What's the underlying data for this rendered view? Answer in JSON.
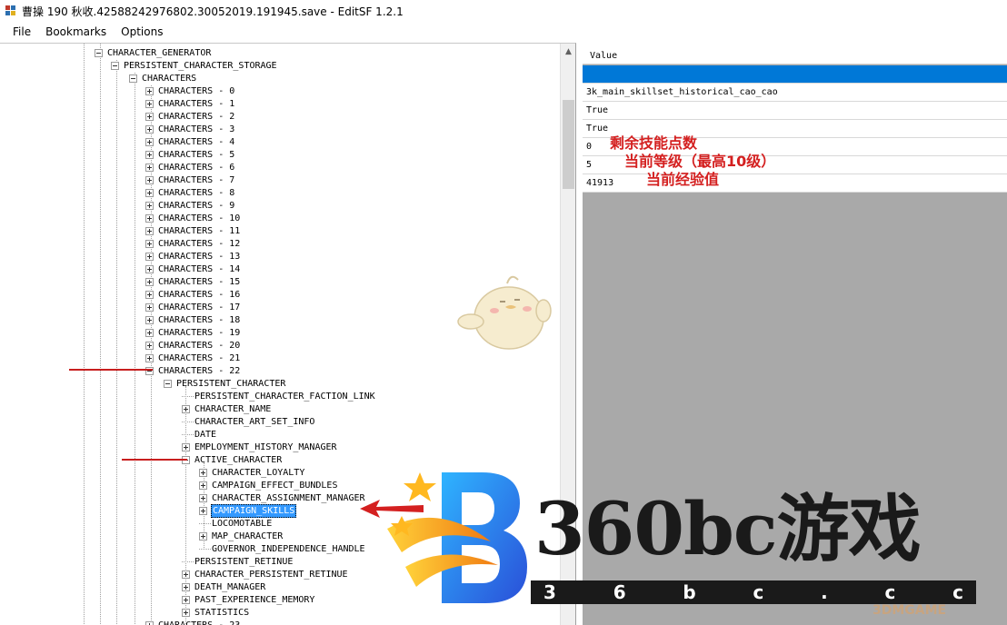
{
  "window": {
    "title": "曹操 190 秋收.42588242976802.30052019.191945.save - EditSF 1.2.1"
  },
  "menu": {
    "items": [
      "File",
      "Bookmarks",
      "Options"
    ]
  },
  "tree": {
    "generator": "CHARACTER_GENERATOR",
    "storage": "PERSISTENT_CHARACTER_STORAGE",
    "characters_root": "CHARACTERS",
    "characters": [
      "CHARACTERS - 0",
      "CHARACTERS - 1",
      "CHARACTERS - 2",
      "CHARACTERS - 3",
      "CHARACTERS - 4",
      "CHARACTERS - 5",
      "CHARACTERS - 6",
      "CHARACTERS - 7",
      "CHARACTERS - 8",
      "CHARACTERS - 9",
      "CHARACTERS - 10",
      "CHARACTERS - 11",
      "CHARACTERS - 12",
      "CHARACTERS - 13",
      "CHARACTERS - 14",
      "CHARACTERS - 15",
      "CHARACTERS - 16",
      "CHARACTERS - 17",
      "CHARACTERS - 18",
      "CHARACTERS - 19",
      "CHARACTERS - 20",
      "CHARACTERS - 21",
      "CHARACTERS - 22"
    ],
    "persistent_character": "PERSISTENT_CHARACTER",
    "pc_children": [
      {
        "label": "PERSISTENT_CHARACTER_FACTION_LINK",
        "expandable": false
      },
      {
        "label": "CHARACTER_NAME",
        "expandable": true
      },
      {
        "label": "CHARACTER_ART_SET_INFO",
        "expandable": false
      },
      {
        "label": "DATE",
        "expandable": false
      },
      {
        "label": "EMPLOYMENT_HISTORY_MANAGER",
        "expandable": true
      }
    ],
    "active_character": "ACTIVE_CHARACTER",
    "ac_children": [
      {
        "label": "CHARACTER_LOYALTY",
        "expandable": true
      },
      {
        "label": "CAMPAIGN_EFFECT_BUNDLES",
        "expandable": true
      },
      {
        "label": "CHARACTER_ASSIGNMENT_MANAGER",
        "expandable": true
      },
      {
        "label": "CAMPAIGN_SKILLS",
        "expandable": true,
        "selected": true
      },
      {
        "label": "LOCOMOTABLE",
        "expandable": false
      },
      {
        "label": "MAP_CHARACTER",
        "expandable": true
      },
      {
        "label": "GOVERNOR_INDEPENDENCE_HANDLE",
        "expandable": false
      }
    ],
    "pc_after": [
      {
        "label": "PERSISTENT_RETINUE",
        "expandable": false
      },
      {
        "label": "CHARACTER_PERSISTENT_RETINUE",
        "expandable": true
      },
      {
        "label": "DEATH_MANAGER",
        "expandable": true
      },
      {
        "label": "PAST_EXPERIENCE_MEMORY",
        "expandable": true
      },
      {
        "label": "STATISTICS",
        "expandable": true
      }
    ],
    "next_character": "CHARACTERS - 23"
  },
  "grid": {
    "header": "Value",
    "rows": [
      {
        "value": "",
        "highlight": true
      },
      {
        "value": "3k_main_skillset_historical_cao_cao"
      },
      {
        "value": "True"
      },
      {
        "value": "True"
      },
      {
        "value": "0",
        "annotation": "剩余技能点数"
      },
      {
        "value": "5",
        "annotation": "当前等级（最高10级）"
      },
      {
        "value": "41913",
        "annotation": "当前经验值"
      }
    ]
  },
  "watermark": {
    "brand": "360bc游戏",
    "domain_letters": [
      "3",
      "6",
      "b",
      "c",
      ".",
      "c",
      "c"
    ],
    "secondary": "3DMGAME"
  },
  "colors": {
    "selection": "#3399ff",
    "grid_highlight": "#0078d7",
    "annotation": "#d42020",
    "grid_background": "#a9a9a9"
  }
}
